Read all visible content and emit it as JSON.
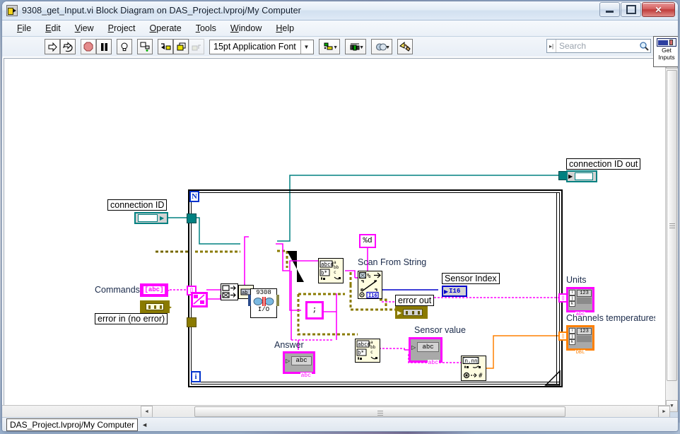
{
  "window": {
    "title": "9308_get_Input.vi Block Diagram on DAS_Project.lvproj/My Computer",
    "icon": "labview-vi-icon",
    "minimize_label": "–",
    "maximize_label": "□",
    "close_label": "✕"
  },
  "menu": {
    "items": [
      {
        "label": "File",
        "mnemonic": "F"
      },
      {
        "label": "Edit",
        "mnemonic": "E"
      },
      {
        "label": "View",
        "mnemonic": "V"
      },
      {
        "label": "Project",
        "mnemonic": "P"
      },
      {
        "label": "Operate",
        "mnemonic": "O"
      },
      {
        "label": "Tools",
        "mnemonic": "T"
      },
      {
        "label": "Window",
        "mnemonic": "W"
      },
      {
        "label": "Help",
        "mnemonic": "H"
      }
    ]
  },
  "toolbar": {
    "run_label": "run-arrow",
    "run_continuous_label": "run-continuously",
    "abort_label": "abort-execution",
    "pause_label": "pause",
    "highlight_label": "highlight-execution",
    "retain_values_label": "retain-wire-values",
    "step_into_label": "step-into",
    "step_over_label": "step-over",
    "step_out_label": "step-out",
    "font_selector": "15pt Application Font",
    "font_caret": "▼",
    "align_objects": "align-objects",
    "distribute_objects": "distribute-objects",
    "reorder": "reorder",
    "clean_up_diagram": "clean-up-diagram",
    "search_placeholder": "Search",
    "help_label": "?",
    "get_inputs_label": "Get\nInputs",
    "get_inputs_line1": "Get",
    "get_inputs_line2": "Inputs"
  },
  "statusbar": {
    "path": "DAS_Project.lvproj/My Computer",
    "arrow": "◄"
  },
  "diagram": {
    "loop": {
      "count_terminal": "N",
      "iteration_terminal": "i"
    },
    "labels": {
      "connection_id": "connection ID",
      "commands": "Commands",
      "error_in": "error in (no error)",
      "scan_from_string": "Scan From String",
      "format_string": "%d",
      "sensor_index": "Sensor Index",
      "sensor_index_type": "I16",
      "error_out": "error out",
      "answer": "Answer",
      "answer_type": "abc",
      "sensor_value": "Sensor value",
      "sensor_value_type": "abc",
      "connection_id_out": "connection ID out",
      "units": "Units",
      "units_type": "abc",
      "channels_temperatures": "Channels temperatures",
      "channels_type": "DBL",
      "semicolon_constant": ";",
      "array_index_empty": "[]",
      "visa_node": "9308",
      "visa_node_sub": "I/O",
      "number_to_fractional": "n.nn",
      "array_type_123": "123",
      "array_idx_i": "i",
      "array_idx_j": "j",
      "array_idx_k": "k",
      "string_subset_abc": "abc",
      "string_subset_bx": "b*",
      "string_subset_a": "a",
      "string_subset_bb": "bb",
      "string_subset_c": "c",
      "scan_percent": "%",
      "scan_i16": "I16"
    },
    "colors": {
      "string_wire": "#ff00ff",
      "error_wire": "#8a7a00",
      "visa_wire": "#008080",
      "numeric_dbl_wire": "#ff8000",
      "integer_wire": "#0000cc",
      "node_fill": "#fffde0",
      "terminal_fill": "#d3d3d3",
      "canvas_bg": "#ffffff"
    }
  }
}
